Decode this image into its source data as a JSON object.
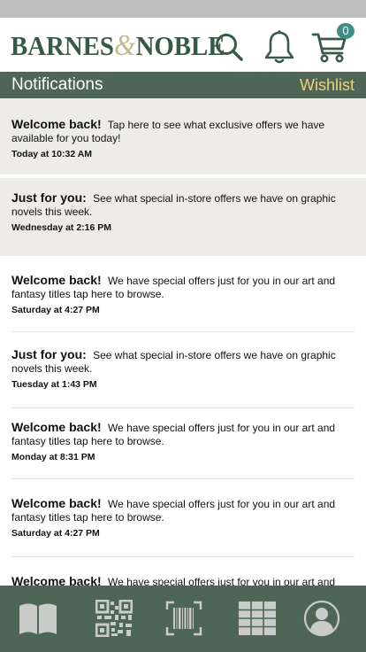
{
  "header": {
    "logo_left": "BARNES",
    "logo_amp": "&",
    "logo_right": "NOBLE",
    "cart_count": "0"
  },
  "title_bar": {
    "title": "Notifications",
    "wishlist": "Wishlist"
  },
  "notifications": [
    {
      "heading": "Welcome back!",
      "body": "Tap here to see what exclusive offers we have available for you today!",
      "time": "Today at 10:32 AM",
      "unread": true
    },
    {
      "heading": "Just for you:",
      "body": "See what special in-store offers we have on graphic novels this week.",
      "time": "Wednesday at 2:16 PM",
      "unread": true
    },
    {
      "heading": "Welcome back!",
      "body": "We have special offers just for you in our art and fantasy titles tap here to browse.",
      "time": "Saturday at 4:27 PM",
      "unread": false
    },
    {
      "heading": "Just for you:",
      "body": "See what special in-store offers we have on graphic novels this week.",
      "time": "Tuesday at 1:43 PM",
      "unread": false
    },
    {
      "heading": "Welcome back!",
      "body": "We have special offers just for you in our art and fantasy titles tap here to browse.",
      "time": "Monday at 8:31 PM",
      "unread": false
    },
    {
      "heading": "Welcome back!",
      "body": "We have special offers just for you in our art and fantasy titles tap here to browse.",
      "time": "Saturday at 4:27 PM",
      "unread": false
    },
    {
      "heading": "Welcome back!",
      "body": "We have special offers just for you in our art and fantasy",
      "time": "",
      "unread": false
    }
  ],
  "icons": {
    "search": "search-icon",
    "bell": "bell-icon",
    "cart": "cart-icon",
    "nav": [
      "book-icon",
      "qr-code-icon",
      "barcode-scan-icon",
      "grid-icon",
      "profile-icon"
    ]
  },
  "colors": {
    "brand_green": "#375a48",
    "bar_green": "#4e6655",
    "wishlist_gold": "#efd37a",
    "badge_teal": "#3f8d87",
    "unread_bg": "#eeece8"
  }
}
